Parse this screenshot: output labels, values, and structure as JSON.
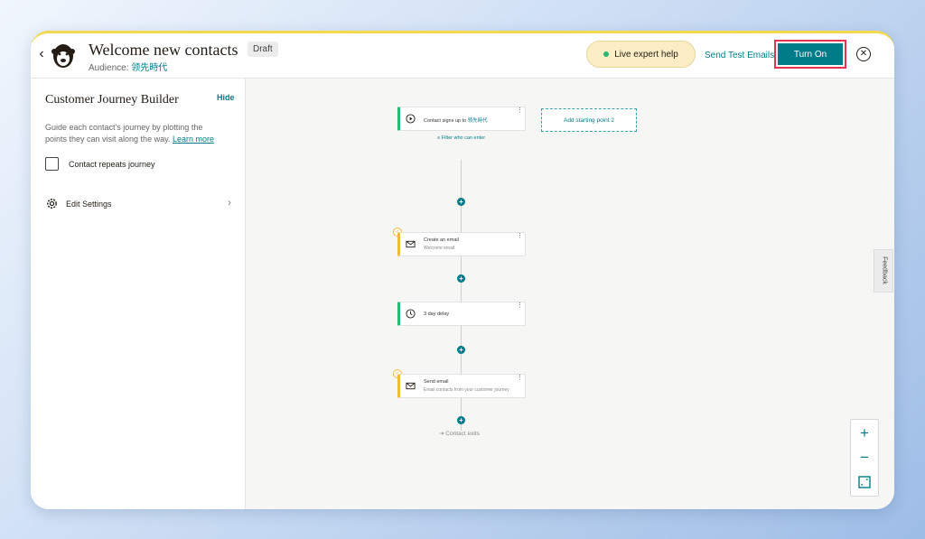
{
  "header": {
    "back_glyph": "‹",
    "title": "Welcome new contacts",
    "status_badge": "Draft",
    "audience_label": "Audience:",
    "audience_value": "领先時代",
    "expert_help": "Live expert help",
    "send_test": "Send Test Emails",
    "turn_on": "Turn On",
    "close_glyph": "✕"
  },
  "sidebar": {
    "title": "Customer Journey Builder",
    "hide": "Hide",
    "description": "Guide each contact's journey by plotting the points they can visit along the way.",
    "learn_more": "Learn more",
    "repeat_label": "Contact repeats journey",
    "repeat_checked": false,
    "settings_label": "Edit Settings",
    "chevron_glyph": "›"
  },
  "canvas": {
    "start_node": {
      "title": "Contact signs up to",
      "audience": "领先時代",
      "icon": "play-icon"
    },
    "add_starting_point": "Add starting point 2",
    "filter": "Filter who can enter",
    "nodes": [
      {
        "title": "Create an email",
        "subtitle": "Welcome email",
        "icon": "mail-icon",
        "warning": true
      },
      {
        "title": "3 day delay",
        "subtitle": "",
        "icon": "clock-icon",
        "warning": false
      },
      {
        "title": "Send email",
        "subtitle": "Email contacts from your customer journey",
        "icon": "mail-icon",
        "warning": true
      }
    ],
    "exit": "Contact exits",
    "feedback": "Feedback",
    "menu_glyph": "⋮",
    "add_glyph": "+",
    "warn_glyph": "✓",
    "zoom_in": "+",
    "zoom_out": "−"
  },
  "colors": {
    "accent": "#007c89",
    "start_accent": "#2bb673",
    "email_accent": "#f4b740",
    "highlight": "#e4334c",
    "top_bar": "#f2d94e"
  }
}
